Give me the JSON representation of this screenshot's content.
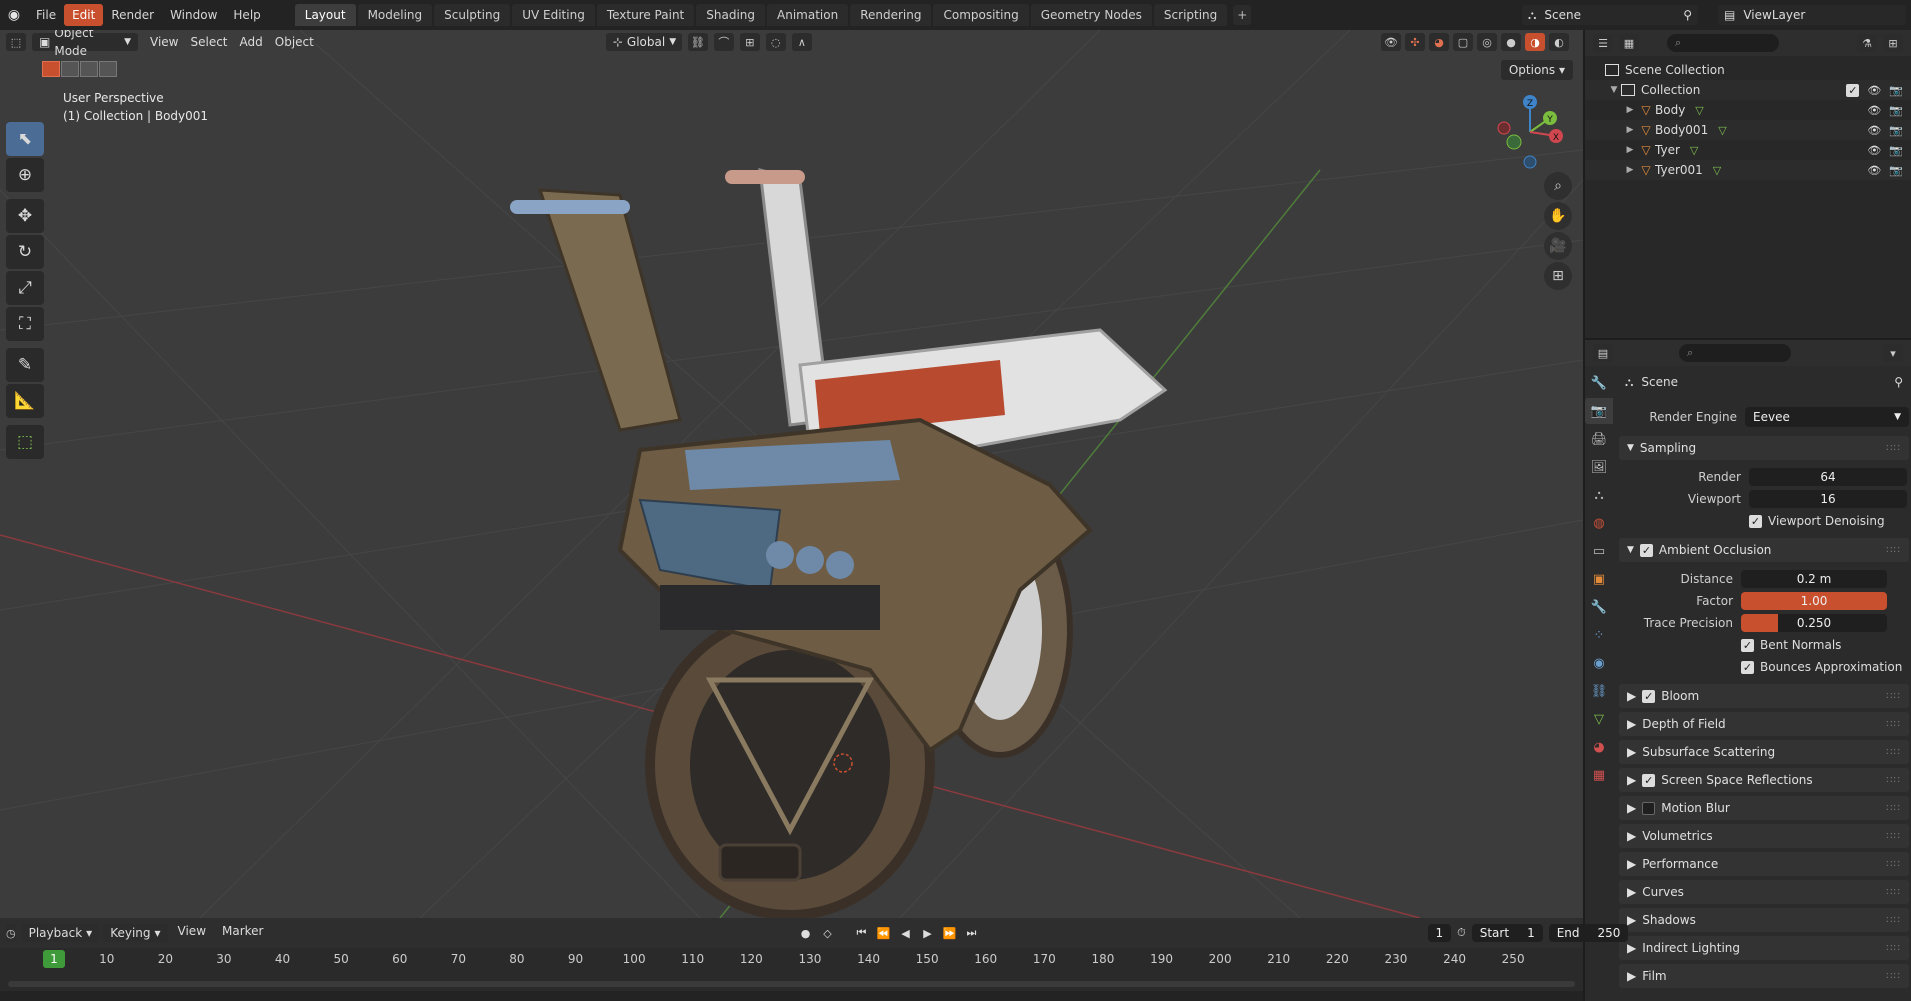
{
  "topbar": {
    "menus": [
      "File",
      "Edit",
      "Render",
      "Window",
      "Help"
    ],
    "active_menu": "Edit",
    "workspaces": [
      "Layout",
      "Modeling",
      "Sculpting",
      "UV Editing",
      "Texture Paint",
      "Shading",
      "Animation",
      "Rendering",
      "Compositing",
      "Geometry Nodes",
      "Scripting"
    ],
    "active_workspace": "Layout",
    "add_workspace": "+",
    "scene": "Scene",
    "view_layer": "ViewLayer"
  },
  "viewport": {
    "mode": "Object Mode",
    "menus": [
      "View",
      "Select",
      "Add",
      "Object"
    ],
    "orientation": "Global",
    "view_name": "User Perspective",
    "view_context": "(1) Collection | Body001",
    "options": "Options",
    "gizmo_axes": {
      "x": "X",
      "y": "Y",
      "z": "Z"
    }
  },
  "outliner": {
    "root": "Scene Collection",
    "collection": "Collection",
    "objects": [
      "Body",
      "Body001",
      "Tyer",
      "Tyer001"
    ]
  },
  "properties": {
    "context": "Scene",
    "render_engine_label": "Render Engine",
    "render_engine": "Eevee",
    "sampling": {
      "title": "Sampling",
      "render_label": "Render",
      "render": "64",
      "viewport_label": "Viewport",
      "viewport": "16",
      "denoise_label": "Viewport Denoising"
    },
    "ao": {
      "title": "Ambient Occlusion",
      "distance_label": "Distance",
      "distance": "0.2 m",
      "factor_label": "Factor",
      "factor": "1.00",
      "factor_fraction": 1.0,
      "precision_label": "Trace Precision",
      "precision": "0.250",
      "precision_fraction": 0.25,
      "bent_label": "Bent Normals",
      "bounces_label": "Bounces Approximation"
    },
    "panels": [
      {
        "label": "Bloom",
        "checkbox": true,
        "checked": true
      },
      {
        "label": "Depth of Field",
        "checkbox": false,
        "checked": false
      },
      {
        "label": "Subsurface Scattering",
        "checkbox": false,
        "checked": false
      },
      {
        "label": "Screen Space Reflections",
        "checkbox": true,
        "checked": true
      },
      {
        "label": "Motion Blur",
        "checkbox": true,
        "checked": false
      },
      {
        "label": "Volumetrics",
        "checkbox": false,
        "checked": false
      },
      {
        "label": "Performance",
        "checkbox": false,
        "checked": false
      },
      {
        "label": "Curves",
        "checkbox": false,
        "checked": false
      },
      {
        "label": "Shadows",
        "checkbox": false,
        "checked": false
      },
      {
        "label": "Indirect Lighting",
        "checkbox": false,
        "checked": false
      },
      {
        "label": "Film",
        "checkbox": false,
        "checked": false
      }
    ]
  },
  "timeline": {
    "menus": [
      "Playback",
      "Keying",
      "View",
      "Marker"
    ],
    "current_frame": "1",
    "start_label": "Start",
    "start": "1",
    "end_label": "End",
    "end": "250",
    "ticks": [
      "10",
      "20",
      "30",
      "40",
      "50",
      "60",
      "70",
      "80",
      "90",
      "100",
      "110",
      "120",
      "130",
      "140",
      "150",
      "160",
      "170",
      "180",
      "190",
      "200",
      "210",
      "220",
      "230",
      "240",
      "250"
    ],
    "marker": "1"
  },
  "colors": {
    "accent": "#c8502f",
    "frame_marker": "#3f9b3a",
    "axis_x": "#d0474f",
    "axis_y": "#7bbd3e",
    "axis_z": "#3f84c8"
  }
}
